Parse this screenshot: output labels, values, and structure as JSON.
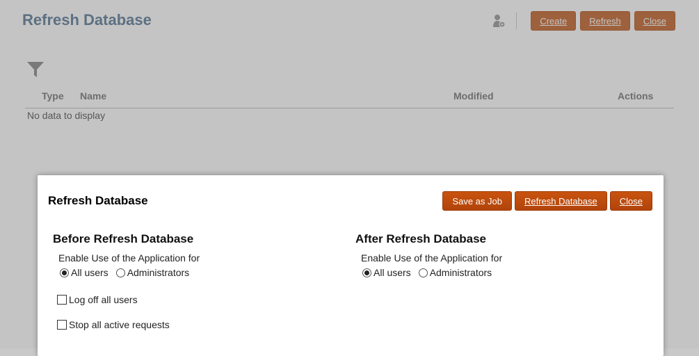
{
  "page": {
    "title": "Refresh Database",
    "toolbar": {
      "create": "Create",
      "refresh": "Refresh",
      "close": "Close"
    },
    "table": {
      "columns": {
        "type": "Type",
        "name": "Name",
        "modified": "Modified",
        "actions": "Actions"
      },
      "empty_message": "No data to display"
    }
  },
  "dialog": {
    "title": "Refresh Database",
    "buttons": {
      "save_as_job": "Save as Job",
      "refresh_database": "Refresh Database",
      "close": "Close"
    },
    "before": {
      "heading": "Before Refresh Database",
      "enable_label": "Enable Use of the Application for",
      "option_all": "All users",
      "option_admin": "Administrators",
      "selected": "All users",
      "log_off": "Log off all users",
      "stop_requests": "Stop all active requests"
    },
    "after": {
      "heading": "After Refresh Database",
      "enable_label": "Enable Use of the Application for",
      "option_all": "All users",
      "option_admin": "Administrators",
      "selected": "All users"
    }
  },
  "icons": {
    "user": "user-settings-icon",
    "filter": "filter-icon"
  },
  "colors": {
    "accent": "#c0500e",
    "title": "#5f7c98"
  }
}
